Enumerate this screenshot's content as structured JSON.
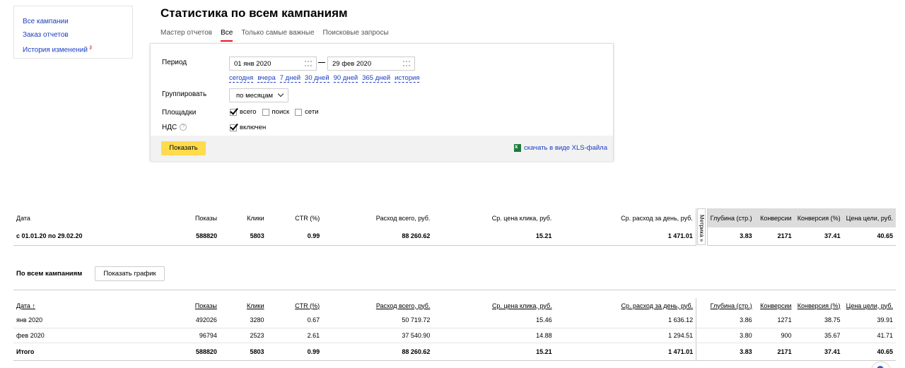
{
  "sidebar": {
    "links": [
      "Все кампании",
      "Заказ отчетов",
      "История изменений"
    ],
    "history_badge": "β"
  },
  "page": {
    "title": "Статистика по всем кампаниям"
  },
  "tabs": [
    "Мастер отчетов",
    "Все",
    "Только самые важные",
    "Поисковые запросы"
  ],
  "form": {
    "period_label": "Период",
    "date_from": "01 янв 2020",
    "date_to": "29 фев 2020",
    "quick_ranges": [
      "сегодня",
      "вчера",
      "7 дней",
      "30 дней",
      "90 дней",
      "365 дней",
      "история"
    ],
    "group_label": "Группировать",
    "group_value": "по месяцам",
    "platforms_label": "Площадки",
    "platforms": [
      {
        "label": "всего",
        "checked": true
      },
      {
        "label": "поиск",
        "checked": false
      },
      {
        "label": "сети",
        "checked": false
      }
    ],
    "vat_label": "НДС",
    "vat_option": "включен",
    "show_button": "Показать",
    "xls_link": "скачать в виде XLS-файла"
  },
  "summary": {
    "headers": [
      "Дата",
      "Показы",
      "Клики",
      "CTR (%)",
      "Расход всего, руб.",
      "Ср. цена клика, руб.",
      "Ср. расход за день, руб.",
      "Глубина (стр.)",
      "Конверсии",
      "Конверсия (%)",
      "Цена цели, руб."
    ],
    "metrika_label": "Метрика »",
    "row": [
      "с 01.01.20 по 29.02.20",
      "588820",
      "5803",
      "0.99",
      "88 260.62",
      "15.21",
      "1 471.01",
      "3.83",
      "2171",
      "37.41",
      "40.65"
    ]
  },
  "campaigns": {
    "label": "По всем кампаниям",
    "graph_button": "Показать график",
    "headers": [
      "Дата ↑",
      "Показы",
      "Клики",
      "CTR (%)",
      "Расход всего, руб.",
      "Ср. цена клика, руб.",
      "Ср. расход за день, руб.",
      "Глубина (стр.)",
      "Конверсии",
      "Конверсия (%)",
      "Цена цели, руб."
    ],
    "rows": [
      [
        "янв 2020",
        "492026",
        "3280",
        "0.67",
        "50 719.72",
        "15.46",
        "1 636.12",
        "3.86",
        "1271",
        "38.75",
        "39.91"
      ],
      [
        "фев 2020",
        "96794",
        "2523",
        "2.61",
        "37 540.90",
        "14.88",
        "1 294.51",
        "3.80",
        "900",
        "35.67",
        "41.71"
      ]
    ],
    "total": [
      "Итого",
      "588820",
      "5803",
      "0.99",
      "88 260.62",
      "15.21",
      "1 471.01",
      "3.83",
      "2171",
      "37.41",
      "40.65"
    ]
  },
  "colors": {
    "link": "#1a3dc1",
    "button": "#ffdb4d",
    "active_tab": "#ee1122"
  }
}
